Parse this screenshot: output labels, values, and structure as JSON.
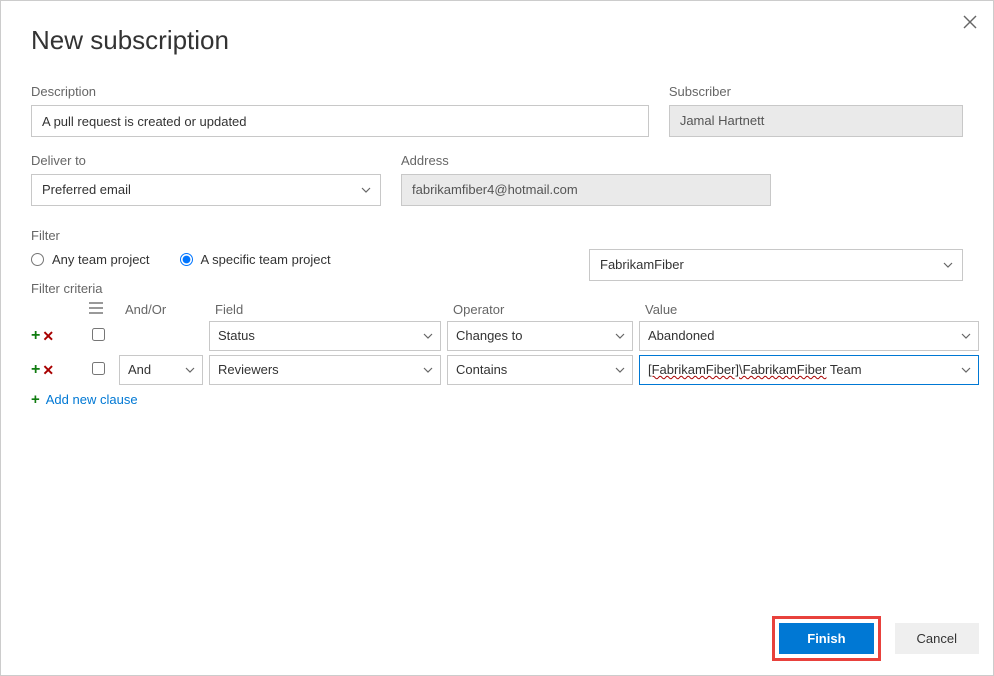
{
  "title": "New subscription",
  "labels": {
    "description": "Description",
    "subscriber": "Subscriber",
    "deliverTo": "Deliver to",
    "address": "Address",
    "filter": "Filter",
    "filterCriteria": "Filter criteria",
    "andOr": "And/Or",
    "field": "Field",
    "operator": "Operator",
    "value": "Value"
  },
  "description": "A pull request is created or updated",
  "subscriber": "Jamal Hartnett",
  "deliverTo": "Preferred email",
  "address": "fabrikamfiber4@hotmail.com",
  "filter": {
    "radioAny": "Any team project",
    "radioSpecific": "A specific team project",
    "selected": "specific",
    "project": "FabrikamFiber"
  },
  "criteria": {
    "rows": [
      {
        "andOr": "",
        "field": "Status",
        "operator": "Changes to",
        "value": "Abandoned",
        "focused": false
      },
      {
        "andOr": "And",
        "field": "Reviewers",
        "operator": "Contains",
        "value": "[FabrikamFiber]\\FabrikamFiber Team",
        "focused": true,
        "squigglyValue": "[FabrikamFiber]\\FabrikamFiber"
      }
    ],
    "addNew": "Add new clause"
  },
  "buttons": {
    "finish": "Finish",
    "cancel": "Cancel"
  }
}
